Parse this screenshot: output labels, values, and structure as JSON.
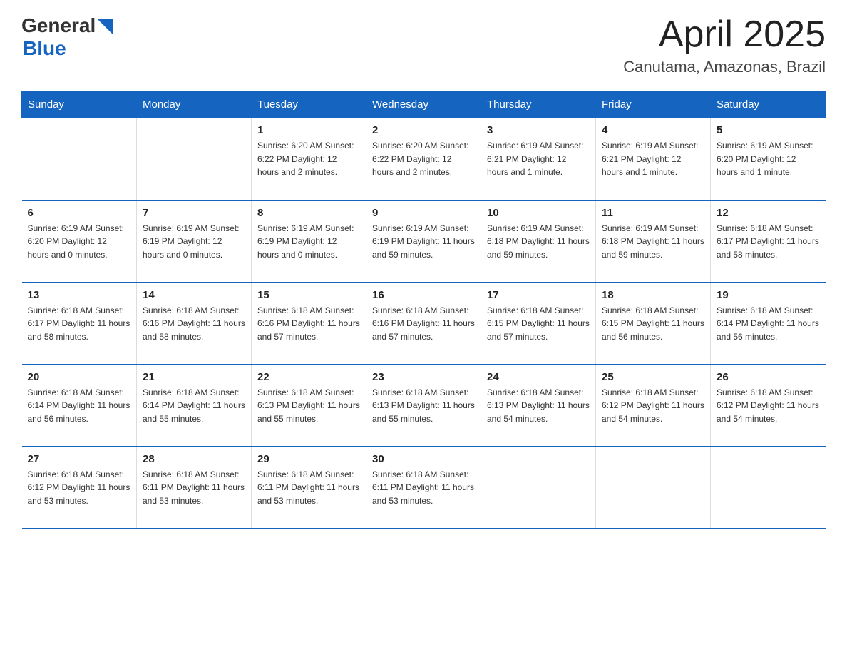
{
  "header": {
    "logo_general": "General",
    "logo_blue": "Blue",
    "month": "April 2025",
    "location": "Canutama, Amazonas, Brazil"
  },
  "weekdays": [
    "Sunday",
    "Monday",
    "Tuesday",
    "Wednesday",
    "Thursday",
    "Friday",
    "Saturday"
  ],
  "weeks": [
    [
      {
        "day": "",
        "info": ""
      },
      {
        "day": "",
        "info": ""
      },
      {
        "day": "1",
        "info": "Sunrise: 6:20 AM\nSunset: 6:22 PM\nDaylight: 12 hours\nand 2 minutes."
      },
      {
        "day": "2",
        "info": "Sunrise: 6:20 AM\nSunset: 6:22 PM\nDaylight: 12 hours\nand 2 minutes."
      },
      {
        "day": "3",
        "info": "Sunrise: 6:19 AM\nSunset: 6:21 PM\nDaylight: 12 hours\nand 1 minute."
      },
      {
        "day": "4",
        "info": "Sunrise: 6:19 AM\nSunset: 6:21 PM\nDaylight: 12 hours\nand 1 minute."
      },
      {
        "day": "5",
        "info": "Sunrise: 6:19 AM\nSunset: 6:20 PM\nDaylight: 12 hours\nand 1 minute."
      }
    ],
    [
      {
        "day": "6",
        "info": "Sunrise: 6:19 AM\nSunset: 6:20 PM\nDaylight: 12 hours\nand 0 minutes."
      },
      {
        "day": "7",
        "info": "Sunrise: 6:19 AM\nSunset: 6:19 PM\nDaylight: 12 hours\nand 0 minutes."
      },
      {
        "day": "8",
        "info": "Sunrise: 6:19 AM\nSunset: 6:19 PM\nDaylight: 12 hours\nand 0 minutes."
      },
      {
        "day": "9",
        "info": "Sunrise: 6:19 AM\nSunset: 6:19 PM\nDaylight: 11 hours\nand 59 minutes."
      },
      {
        "day": "10",
        "info": "Sunrise: 6:19 AM\nSunset: 6:18 PM\nDaylight: 11 hours\nand 59 minutes."
      },
      {
        "day": "11",
        "info": "Sunrise: 6:19 AM\nSunset: 6:18 PM\nDaylight: 11 hours\nand 59 minutes."
      },
      {
        "day": "12",
        "info": "Sunrise: 6:18 AM\nSunset: 6:17 PM\nDaylight: 11 hours\nand 58 minutes."
      }
    ],
    [
      {
        "day": "13",
        "info": "Sunrise: 6:18 AM\nSunset: 6:17 PM\nDaylight: 11 hours\nand 58 minutes."
      },
      {
        "day": "14",
        "info": "Sunrise: 6:18 AM\nSunset: 6:16 PM\nDaylight: 11 hours\nand 58 minutes."
      },
      {
        "day": "15",
        "info": "Sunrise: 6:18 AM\nSunset: 6:16 PM\nDaylight: 11 hours\nand 57 minutes."
      },
      {
        "day": "16",
        "info": "Sunrise: 6:18 AM\nSunset: 6:16 PM\nDaylight: 11 hours\nand 57 minutes."
      },
      {
        "day": "17",
        "info": "Sunrise: 6:18 AM\nSunset: 6:15 PM\nDaylight: 11 hours\nand 57 minutes."
      },
      {
        "day": "18",
        "info": "Sunrise: 6:18 AM\nSunset: 6:15 PM\nDaylight: 11 hours\nand 56 minutes."
      },
      {
        "day": "19",
        "info": "Sunrise: 6:18 AM\nSunset: 6:14 PM\nDaylight: 11 hours\nand 56 minutes."
      }
    ],
    [
      {
        "day": "20",
        "info": "Sunrise: 6:18 AM\nSunset: 6:14 PM\nDaylight: 11 hours\nand 56 minutes."
      },
      {
        "day": "21",
        "info": "Sunrise: 6:18 AM\nSunset: 6:14 PM\nDaylight: 11 hours\nand 55 minutes."
      },
      {
        "day": "22",
        "info": "Sunrise: 6:18 AM\nSunset: 6:13 PM\nDaylight: 11 hours\nand 55 minutes."
      },
      {
        "day": "23",
        "info": "Sunrise: 6:18 AM\nSunset: 6:13 PM\nDaylight: 11 hours\nand 55 minutes."
      },
      {
        "day": "24",
        "info": "Sunrise: 6:18 AM\nSunset: 6:13 PM\nDaylight: 11 hours\nand 54 minutes."
      },
      {
        "day": "25",
        "info": "Sunrise: 6:18 AM\nSunset: 6:12 PM\nDaylight: 11 hours\nand 54 minutes."
      },
      {
        "day": "26",
        "info": "Sunrise: 6:18 AM\nSunset: 6:12 PM\nDaylight: 11 hours\nand 54 minutes."
      }
    ],
    [
      {
        "day": "27",
        "info": "Sunrise: 6:18 AM\nSunset: 6:12 PM\nDaylight: 11 hours\nand 53 minutes."
      },
      {
        "day": "28",
        "info": "Sunrise: 6:18 AM\nSunset: 6:11 PM\nDaylight: 11 hours\nand 53 minutes."
      },
      {
        "day": "29",
        "info": "Sunrise: 6:18 AM\nSunset: 6:11 PM\nDaylight: 11 hours\nand 53 minutes."
      },
      {
        "day": "30",
        "info": "Sunrise: 6:18 AM\nSunset: 6:11 PM\nDaylight: 11 hours\nand 53 minutes."
      },
      {
        "day": "",
        "info": ""
      },
      {
        "day": "",
        "info": ""
      },
      {
        "day": "",
        "info": ""
      }
    ]
  ]
}
